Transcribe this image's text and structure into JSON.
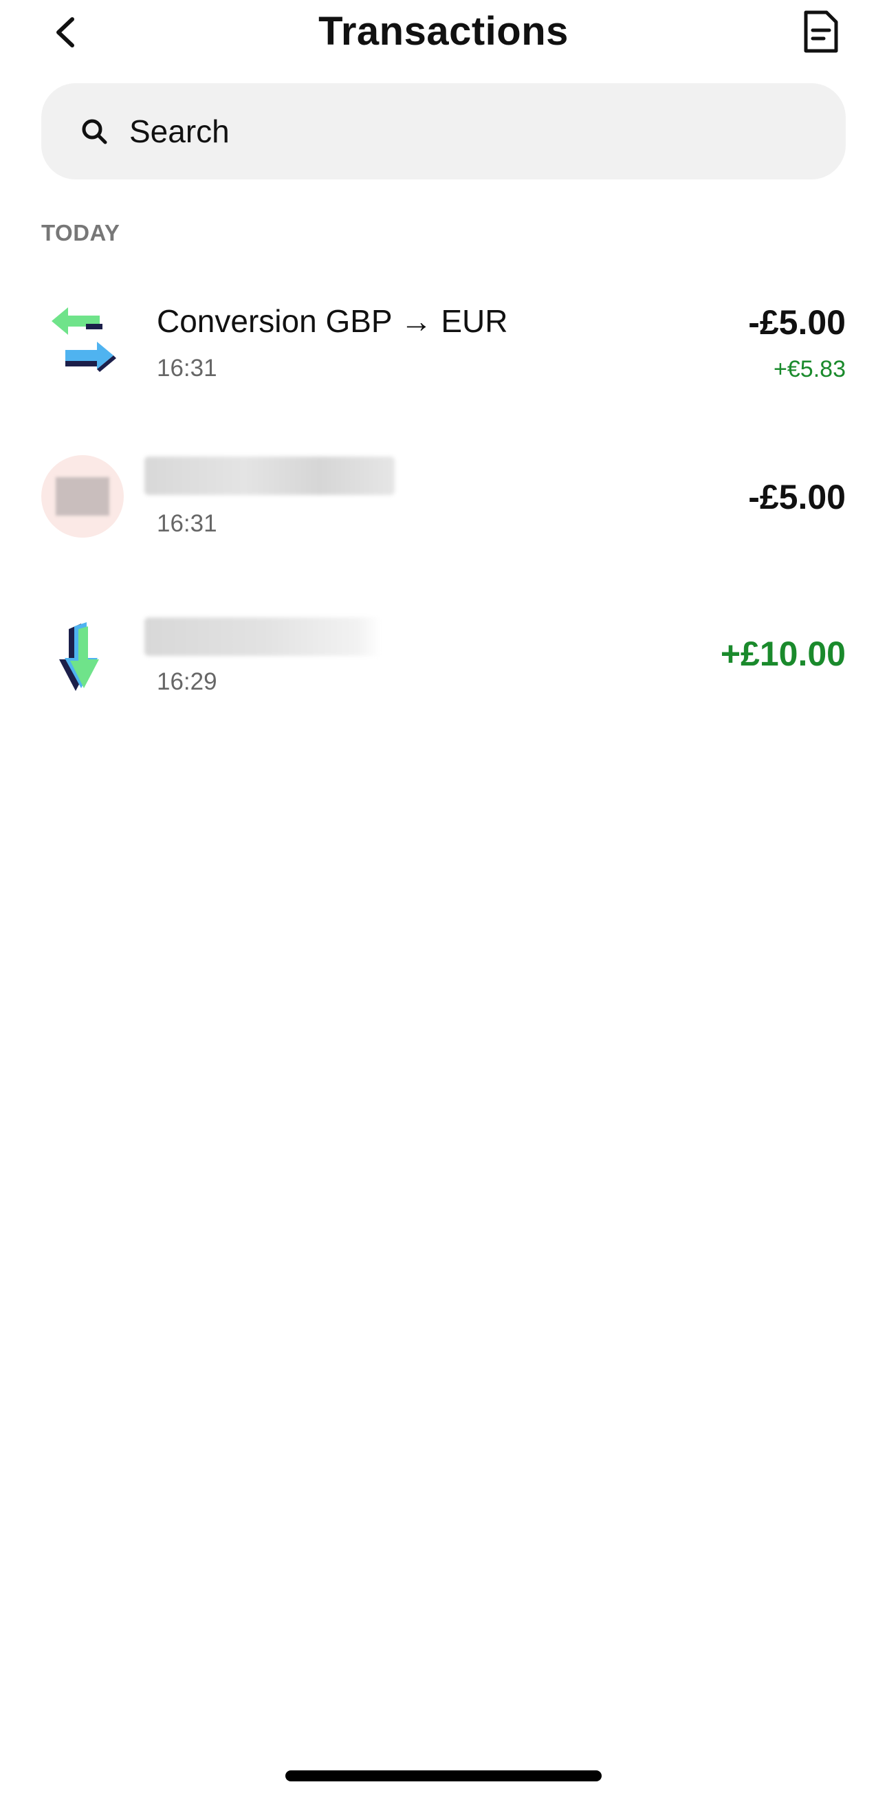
{
  "header": {
    "title": "Transactions",
    "back_icon": "chevron-left-icon",
    "statement_icon": "document-icon"
  },
  "search": {
    "placeholder": "Search",
    "icon": "search-icon"
  },
  "section": {
    "label": "TODAY"
  },
  "transactions": [
    {
      "title": "Conversion GBP → EUR",
      "time": "16:31",
      "amount": "-£5.00",
      "sub_amount": "+€5.83",
      "icon": "exchange-arrows-icon"
    },
    {
      "title": "",
      "time": "16:31",
      "amount": "-£5.00",
      "icon": "merchant-avatar-icon"
    },
    {
      "title": "",
      "time": "16:29",
      "amount": "+£10.00",
      "icon": "incoming-arrow-icon"
    }
  ],
  "colors": {
    "positive": "#1a8a2c",
    "search_bg": "#f1f1f1",
    "avatar_bg": "#fbe9e6",
    "arrow_green": "#6fe38a",
    "arrow_blue": "#4fb3f0",
    "arrow_navy": "#1c1f4a"
  }
}
